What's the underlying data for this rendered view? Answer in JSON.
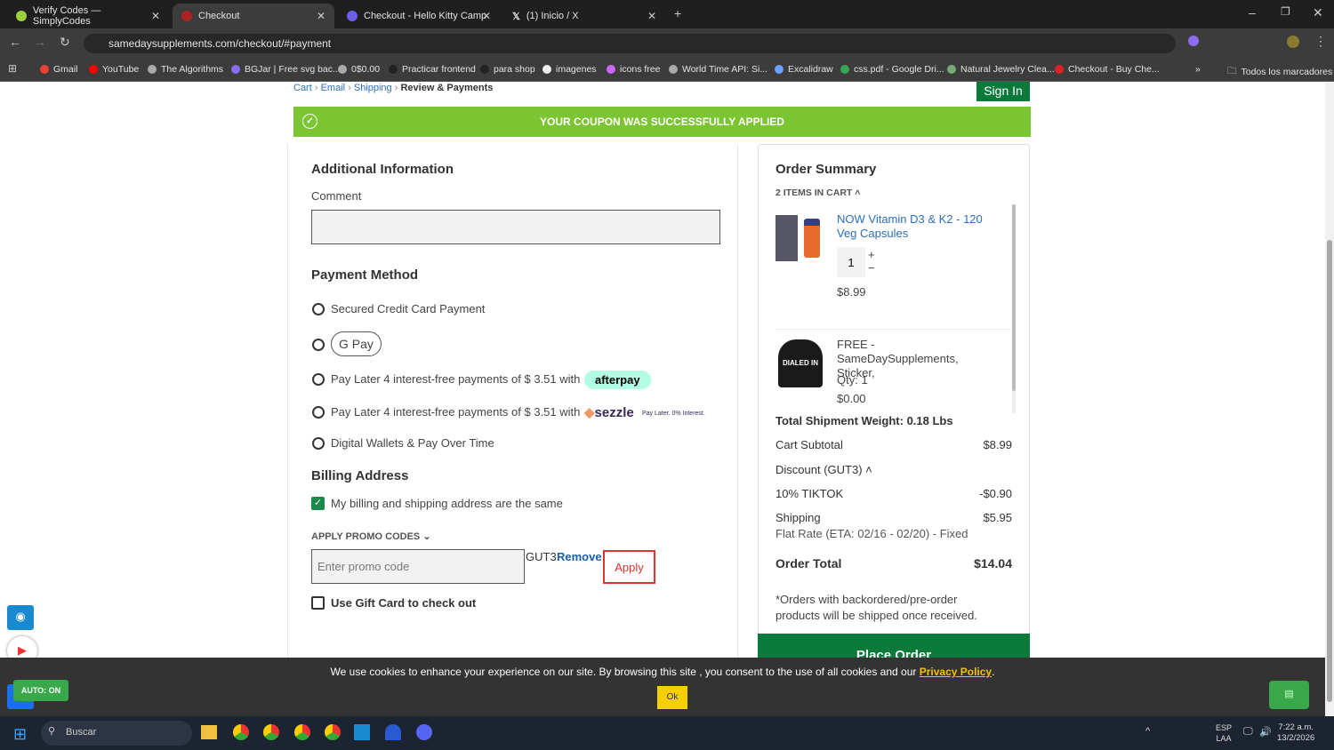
{
  "browser": {
    "tabs": [
      {
        "title": "Verify Codes — SimplyCodes"
      },
      {
        "title": "Checkout"
      },
      {
        "title": "Checkout - Hello Kitty Camp"
      },
      {
        "title": "(1) Inicio / X"
      }
    ],
    "url": "samedaysupplements.com/checkout/#payment",
    "bookmarks": [
      "Gmail",
      "YouTube",
      "The Algorithms",
      "BGJar | Free svg bac...",
      "0$0.00",
      "Practicar frontend",
      "para shop",
      "imagenes",
      "icons free",
      "World Time API: Si...",
      "Excalidraw",
      "css.pdf - Google Dri...",
      "Natural Jewelry Clea...",
      "Checkout - Buy Che..."
    ],
    "all_bookmarks": "Todos los marcadores"
  },
  "breadcrumb": {
    "items": [
      "Cart",
      "Email",
      "Shipping"
    ],
    "current": "Review & Payments"
  },
  "sign_in": "Sign In",
  "coupon_banner": "YOUR COUPON WAS SUCCESSFULLY APPLIED",
  "additional": {
    "title": "Additional Information",
    "comment_label": "Comment",
    "comment_value": ""
  },
  "payment": {
    "title": "Payment Method",
    "options": [
      "Secured Credit Card Payment",
      "G Pay",
      "Pay Later 4 interest-free payments of $ 3.51 with",
      "Pay Later 4 interest-free payments of $ 3.51 with",
      "Digital Wallets & Pay Over Time"
    ],
    "afterpay": "afterpay",
    "sezzle": "sezzle",
    "sezzle_tag": "Pay Later. 0% Interest."
  },
  "billing": {
    "title": "Billing Address",
    "same_label": "My billing and shipping address are the same",
    "same_checked": true
  },
  "promo": {
    "toggle": "APPLY PROMO CODES",
    "placeholder": "Enter promo code",
    "applied_code": "GUT3",
    "remove": "Remove",
    "apply": "Apply"
  },
  "gift_card": {
    "label": "Use Gift Card to check out",
    "checked": false
  },
  "summary": {
    "title": "Order Summary",
    "items_count": "2 ITEMS IN CART",
    "items": [
      {
        "name": "NOW Vitamin D3 & K2 - 120 Veg Capsules",
        "qty": "1",
        "price": "$8.99"
      },
      {
        "name": "FREE - SameDaySupplements, Sticker,",
        "qty": "Qty: 1",
        "price": "$0.00",
        "image_text": "DIALED IN"
      }
    ],
    "weight": "Total Shipment Weight: 0.18 Lbs",
    "subtotal_label": "Cart Subtotal",
    "subtotal": "$8.99",
    "discount_label": "Discount (GUT3)",
    "discount_name": "10% TIKTOK",
    "discount": "-$0.90",
    "shipping_label": "Shipping",
    "shipping": "$5.95",
    "shipping_method": "Flat Rate (ETA: 02/16 - 02/20) - Fixed",
    "total_label": "Order Total",
    "total": "$14.04",
    "note": "*Orders with backordered/pre-order products will be shipped once received.",
    "place_order": "Place Order"
  },
  "cookie": {
    "text": "We use cookies to enhance your experience on our site. By browsing this site , you consent to the use of all cookies and our",
    "link": "Privacy Policy",
    "ok": "Ok"
  },
  "auto": "AUTO: ON",
  "taskbar": {
    "search": "Buscar",
    "lang1": "ESP",
    "lang2": "LAA",
    "time": "7:22 a.m.",
    "date": "13/2/2026"
  }
}
